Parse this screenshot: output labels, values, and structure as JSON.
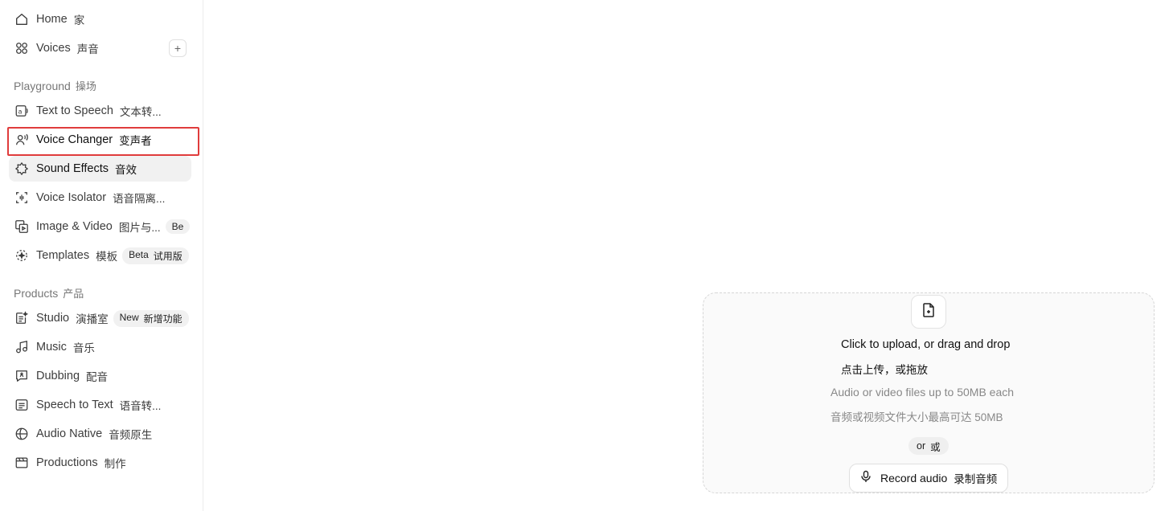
{
  "sidebar": {
    "home": {
      "label": "Home",
      "label_cn": "家",
      "icon": "home-icon"
    },
    "voices": {
      "label": "Voices",
      "label_cn": "声音",
      "icon": "voices-grid-icon",
      "add_label": "+"
    },
    "playground": {
      "title": "Playground",
      "title_cn": "操场",
      "items": [
        {
          "label": "Text to Speech",
          "label_cn": "文本转...",
          "icon": "text-to-speech-icon"
        },
        {
          "label": "Voice Changer",
          "label_cn": "变声者",
          "icon": "voice-changer-icon"
        },
        {
          "label": "Sound Effects",
          "label_cn": "音效",
          "icon": "sound-effects-icon"
        },
        {
          "label": "Voice Isolator",
          "label_cn": "语音隔离...",
          "icon": "voice-isolator-icon"
        },
        {
          "label": "Image & Video",
          "label_cn": "图片与...",
          "icon": "image-video-icon",
          "badge": "Be"
        },
        {
          "label": "Templates",
          "label_cn": "模板",
          "icon": "templates-icon",
          "badge": "Beta",
          "badge_cn": "试用版"
        }
      ]
    },
    "products": {
      "title": "Products",
      "title_cn": "产品",
      "items": [
        {
          "label": "Studio",
          "label_cn": "演播室",
          "icon": "studio-icon",
          "badge": "New",
          "badge_cn": "新增功能"
        },
        {
          "label": "Music",
          "label_cn": "音乐",
          "icon": "music-icon"
        },
        {
          "label": "Dubbing",
          "label_cn": "配音",
          "icon": "dubbing-icon"
        },
        {
          "label": "Speech to Text",
          "label_cn": "语音转...",
          "icon": "speech-to-text-icon"
        },
        {
          "label": "Audio Native",
          "label_cn": "音频原生",
          "icon": "audio-native-icon"
        },
        {
          "label": "Productions",
          "label_cn": "制作",
          "icon": "productions-icon"
        }
      ]
    }
  },
  "upload": {
    "title": "Click to upload, or drag and drop",
    "title_cn": "点击上传，或拖放",
    "subtitle": "Audio or video files up to 50MB each",
    "subtitle_cn": "音频或视频文件大小最高可达 50MB",
    "or": "or",
    "or_cn": "或",
    "record_label": "Record audio",
    "record_label_cn": "录制音频"
  },
  "colors": {
    "highlight": "#e03c3c",
    "active_bg": "#f1f1f1"
  }
}
